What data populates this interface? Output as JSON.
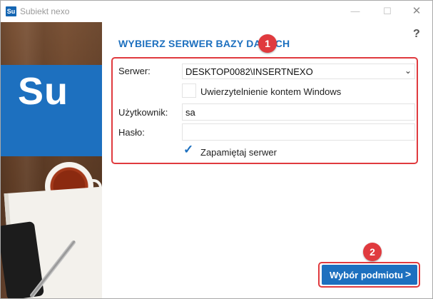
{
  "window": {
    "app_icon_text": "Su",
    "title": "Subiekt nexo",
    "minimize_glyph": "—",
    "maximize_glyph": "☐",
    "close_glyph": "✕"
  },
  "brand": {
    "logo_text": "Su",
    "color": "#1d70bf"
  },
  "help": {
    "label": "?"
  },
  "heading": "WYBIERZ SERWER BAZY DANYCH",
  "annotations": {
    "badge_1": "1",
    "badge_2": "2",
    "color": "#e03a3e"
  },
  "form": {
    "server_label": "Serwer:",
    "server_value": "DESKTOP0082\\INSERTNEXO",
    "windows_auth_label": "Uwierzytelnienie kontem Windows",
    "windows_auth_checked": false,
    "user_label": "Użytkownik:",
    "user_value": "sa",
    "password_label": "Hasło:",
    "password_value": "",
    "remember_label": "Zapamiętaj serwer",
    "remember_checked": true
  },
  "actions": {
    "primary_label": "Wybór podmiotu",
    "primary_arrow": ">"
  },
  "icons": {
    "dropdown": "chevron-down-icon",
    "check": "checkmark-icon",
    "help": "help-icon"
  }
}
